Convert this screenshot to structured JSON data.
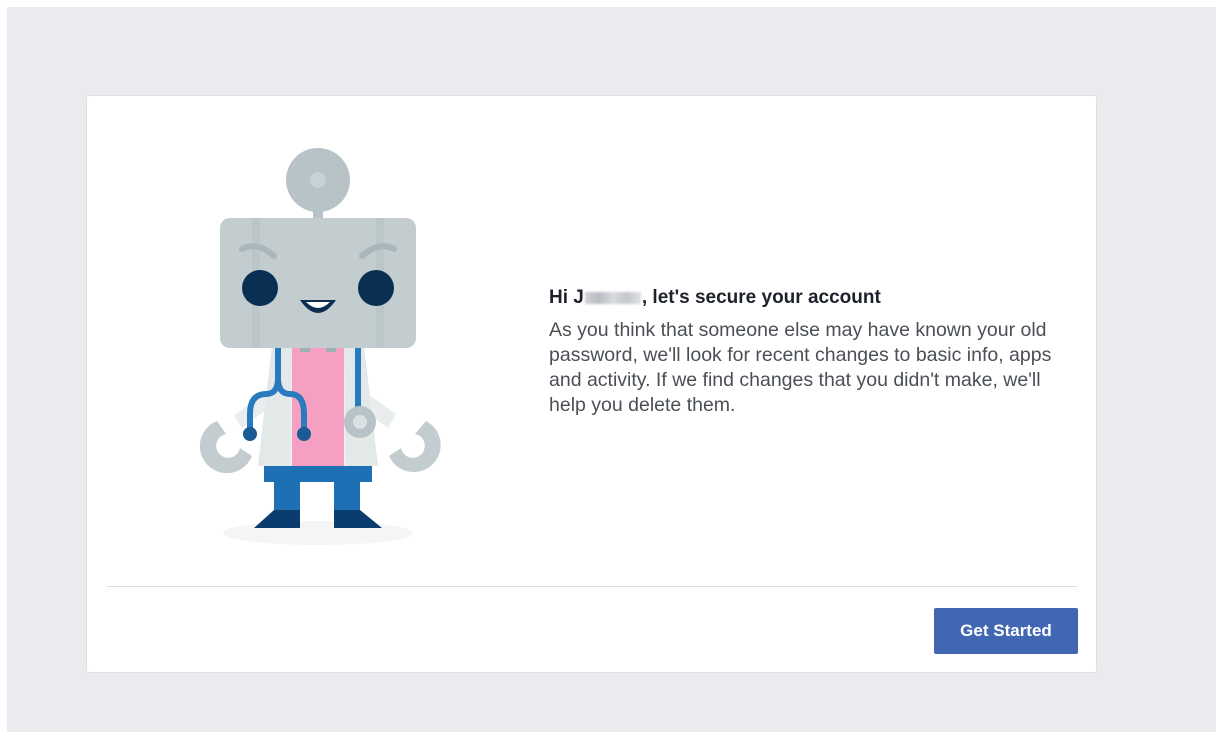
{
  "card": {
    "title_prefix": "Hi J",
    "title_suffix": ", let's secure your account",
    "description": "As you think that someone else may have known your old password, we'll look for recent changes to basic info, apps and activity. If we find changes that you didn't make, we'll help you delete them.",
    "primary_button": "Get Started"
  },
  "illustration": {
    "icon": "doctor-robot-illustration"
  },
  "colors": {
    "page_background": "#e9ebee",
    "card_background": "#ffffff",
    "button_primary": "#4267b2",
    "robot_head": "#c3cdd0",
    "robot_eye": "#0a2f52",
    "robot_shirt": "#f5a0c3",
    "robot_pants": "#1f6fb5",
    "stethoscope": "#2a7ac0"
  }
}
